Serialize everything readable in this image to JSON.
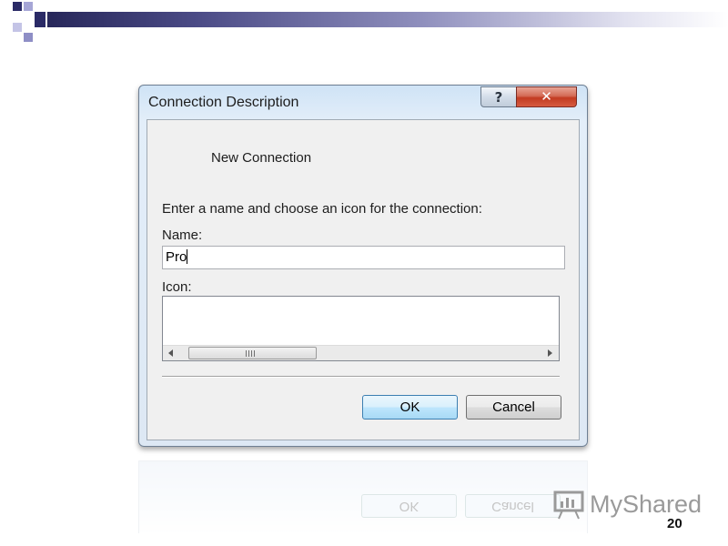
{
  "dialog": {
    "title": "Connection Description",
    "help_glyph": "?",
    "close_glyph": "✕",
    "connection_name": "New Connection",
    "instruction": "Enter a name and choose an icon for the connection:",
    "name_label": "Name:",
    "name_value": "Pro",
    "icon_label": "Icon:",
    "ok_label": "OK",
    "cancel_label": "Cancel"
  },
  "slide": {
    "watermark_text": "MyShared",
    "page_number": "20"
  },
  "colors": {
    "accent": "#3c7fb1",
    "close_red": "#c23b22",
    "header_band": "#27275a"
  }
}
